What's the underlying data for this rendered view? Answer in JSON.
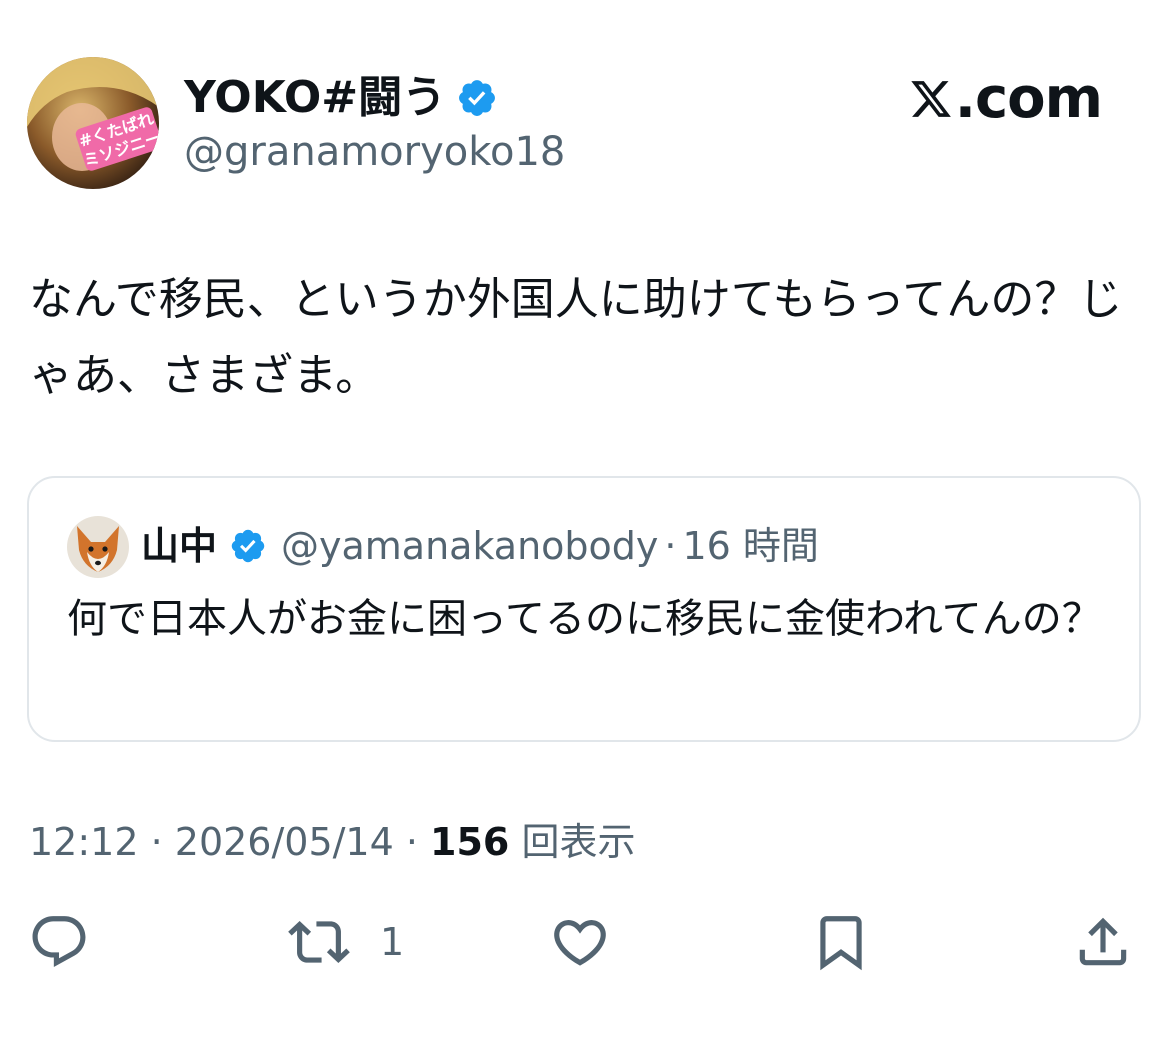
{
  "author": {
    "display_name": "YOKO#闘う",
    "handle": "@granamoryoko18",
    "avatar_caption": "#くたばれミソジニー"
  },
  "brand": {
    "label": ".com"
  },
  "tweet": {
    "text": "なんで移民、というか外国人に助けてもらってんの？じゃあ、さまざま。"
  },
  "quote": {
    "name": "山中",
    "handle": "@yamanakanobody",
    "separator": "·",
    "time": "16 時間",
    "text": "何で日本人がお金に困ってるのに移民に金使われてんの？"
  },
  "meta": {
    "time": "12:12",
    "sep1": " · ",
    "date": "2026/05/14",
    "sep2": " · ",
    "views_count": "156",
    "views_label": " 回表示"
  },
  "actions": {
    "retweet_count": "1"
  },
  "colors": {
    "verified": "#1d9bf0",
    "secondary_text": "#536471",
    "border": "#e1e6ea"
  },
  "icons": {
    "reply": "reply-icon",
    "retweet": "retweet-icon",
    "like": "like-icon",
    "bookmark": "bookmark-icon",
    "share": "share-icon",
    "verified": "verified-badge-icon",
    "brand": "x-logo-icon"
  }
}
